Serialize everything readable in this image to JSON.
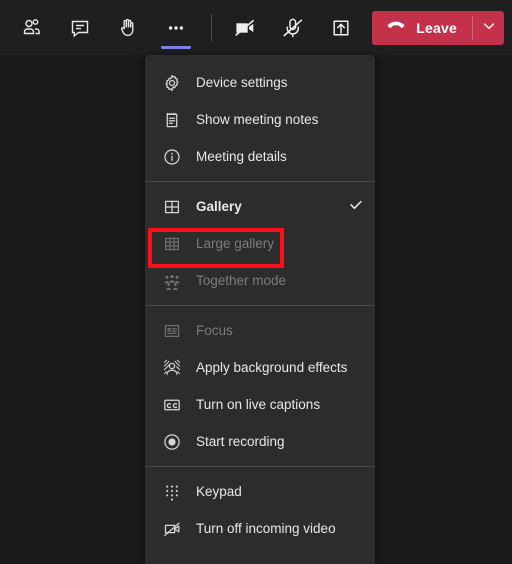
{
  "toolbar": {
    "buttons": [
      {
        "name": "people-icon",
        "label": "Show participants",
        "active": false
      },
      {
        "name": "chat-icon",
        "label": "Show conversation",
        "active": false
      },
      {
        "name": "raise-hand-icon",
        "label": "Raise your hand",
        "active": false
      },
      {
        "name": "more-options-icon",
        "label": "More actions",
        "active": true
      },
      {
        "name": "camera-off-icon",
        "label": "Turn camera on",
        "active": false
      },
      {
        "name": "mic-off-icon",
        "label": "Unmute",
        "active": false
      },
      {
        "name": "share-screen-icon",
        "label": "Share content",
        "active": false
      }
    ],
    "leave": {
      "label": "Leave",
      "icon": "hangup-icon",
      "caret_icon": "chevron-down-icon",
      "color": "#c4314b"
    },
    "active_indicator_color": "#7b83eb"
  },
  "menu": {
    "groups": [
      {
        "items": [
          {
            "label": "Device settings",
            "icon": "gear-icon",
            "disabled": false,
            "checked": false,
            "selected": false
          },
          {
            "label": "Show meeting notes",
            "icon": "notes-icon",
            "disabled": false,
            "checked": false,
            "selected": false
          },
          {
            "label": "Meeting details",
            "icon": "info-icon",
            "disabled": false,
            "checked": false,
            "selected": false
          }
        ]
      },
      {
        "items": [
          {
            "label": "Gallery",
            "icon": "gallery-icon",
            "disabled": false,
            "checked": true,
            "selected": true
          },
          {
            "label": "Large gallery",
            "icon": "large-gallery-icon",
            "disabled": true,
            "checked": false,
            "selected": false
          },
          {
            "label": "Together mode",
            "icon": "together-mode-icon",
            "disabled": true,
            "checked": false,
            "selected": false
          }
        ]
      },
      {
        "items": [
          {
            "label": "Focus",
            "icon": "focus-icon",
            "disabled": true,
            "checked": false,
            "selected": false
          },
          {
            "label": "Apply background effects",
            "icon": "background-effects-icon",
            "disabled": false,
            "checked": false,
            "selected": false
          },
          {
            "label": "Turn on live captions",
            "icon": "closed-captions-icon",
            "disabled": false,
            "checked": false,
            "selected": false
          },
          {
            "label": "Start recording",
            "icon": "record-icon",
            "disabled": false,
            "checked": false,
            "selected": false
          }
        ]
      },
      {
        "items": [
          {
            "label": "Keypad",
            "icon": "keypad-icon",
            "disabled": false,
            "checked": false,
            "selected": false
          },
          {
            "label": "Turn off incoming video",
            "icon": "incoming-video-off-icon",
            "disabled": false,
            "checked": false,
            "selected": false
          }
        ]
      }
    ]
  },
  "annotation": {
    "target_label": "Large gallery",
    "color": "#fa0f1b"
  }
}
